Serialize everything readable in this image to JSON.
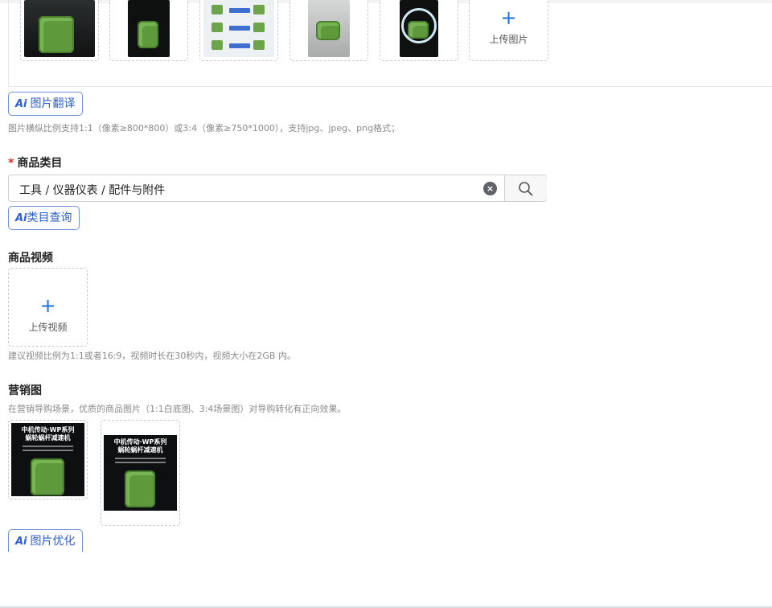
{
  "images": {
    "upload_label": "上传图片",
    "translate_button": "图片翻译",
    "hint": "图片横纵比例支持1:1（像素≥800*800）或3:4（像素≥750*1000），支持jpg、jpeg、png格式；"
  },
  "category": {
    "required_mark": "*",
    "label": "商品类目",
    "value": "工具 / 仪器仪表 / 配件与附件",
    "query_button": "类目查询"
  },
  "video": {
    "label": "商品视频",
    "upload_label": "上传视频",
    "hint": "建议视频比例为1:1或者16:9，视频时长在30秒内，视频大小在2GB 内。"
  },
  "marketing": {
    "label": "营销图",
    "hint": "在营销导购场景，优质的商品图片（1:1白底图、3:4场景图）对导购转化有正向效果。",
    "poster_title_line1": "中机传动·WP系列",
    "poster_title_line2": "蜗轮蜗杆减速机",
    "optimize_button": "图片优化"
  },
  "ai_logo": "Ai",
  "icons": {
    "plus": "+",
    "clear": "×"
  }
}
